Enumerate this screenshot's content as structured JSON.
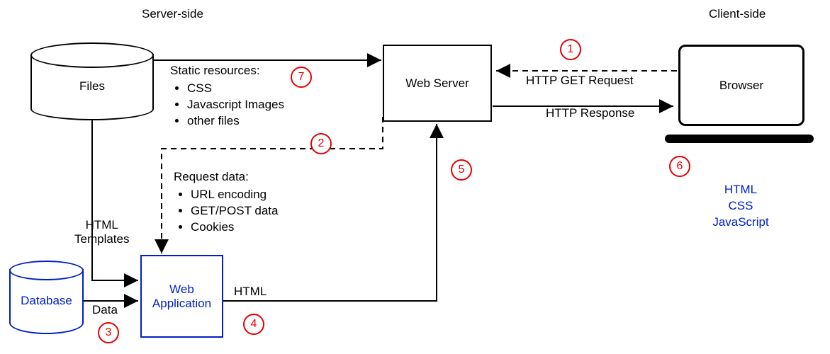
{
  "headings": {
    "server_side": "Server-side",
    "client_side": "Client-side"
  },
  "nodes": {
    "files": "Files",
    "web_server": "Web Server",
    "browser": "Browser",
    "database": "Database",
    "web_application": "Web\nApplication"
  },
  "labels": {
    "html_templates": "HTML\nTemplates",
    "data": "Data",
    "html": "HTML",
    "http_get_request": "HTTP GET Request",
    "http_response": "HTTP Response"
  },
  "static_resources": {
    "title": "Static resources:",
    "items": [
      "CSS",
      "Javascript Images",
      "other files"
    ]
  },
  "request_data": {
    "title": "Request data:",
    "items": [
      "URL encoding",
      "GET/POST data",
      "Cookies"
    ]
  },
  "client_render": {
    "items": [
      "HTML",
      "CSS",
      "JavaScript"
    ]
  },
  "markers": {
    "1": "1",
    "2": "2",
    "3": "3",
    "4": "4",
    "5": "5",
    "6": "6",
    "7": "7"
  },
  "colors": {
    "marker": "#e60000",
    "blue": "#0020c2"
  }
}
